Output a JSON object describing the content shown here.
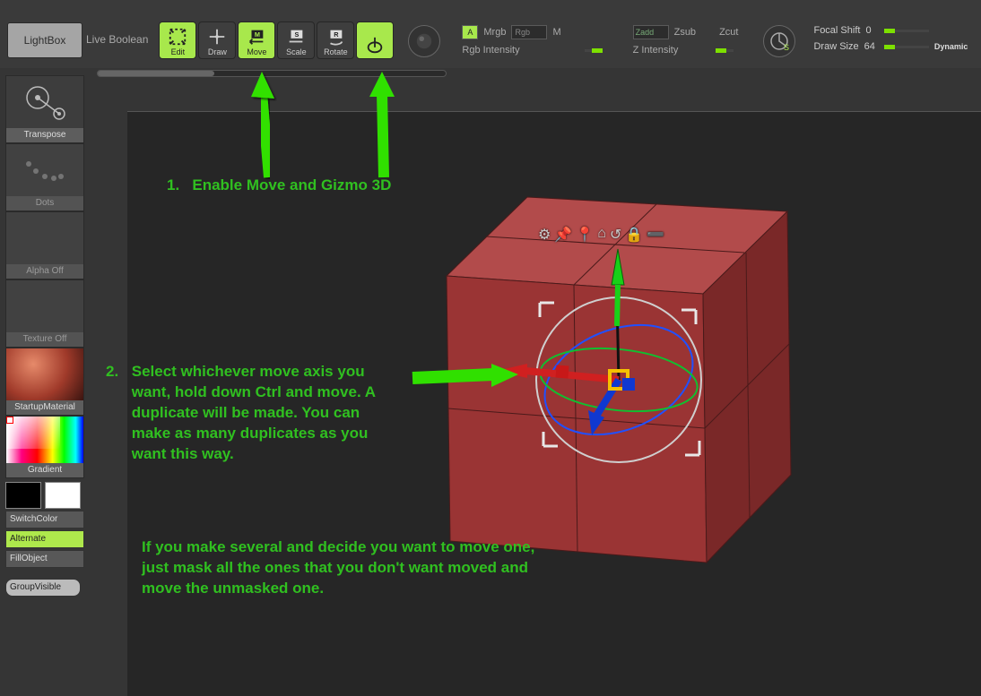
{
  "topbar": {
    "lightbox": "LightBox",
    "live_boolean": "Live Boolean",
    "tools": [
      {
        "id": "edit",
        "label": "Edit",
        "active": true
      },
      {
        "id": "draw",
        "label": "Draw",
        "active": false
      },
      {
        "id": "move",
        "label": "Move",
        "active": true
      },
      {
        "id": "scale",
        "label": "Scale",
        "active": false
      },
      {
        "id": "rotate",
        "label": "Rotate",
        "active": false
      },
      {
        "id": "gizmo",
        "label": "",
        "active": true
      }
    ],
    "color_mode": {
      "a_box": "A",
      "mrgb": "Mrgb",
      "rgb": "Rgb",
      "m": "M",
      "rgb_intensity_label": "Rgb Intensity"
    },
    "depth_mode": {
      "zadd": "Zadd",
      "zsub": "Zsub",
      "zcut": "Zcut",
      "z_intensity_label": "Z Intensity"
    },
    "right": {
      "focal_shift_label": "Focal Shift",
      "focal_shift_value": "0",
      "draw_size_label": "Draw Size",
      "draw_size_value": "64",
      "dynamic": "Dynamic"
    }
  },
  "sidebar": {
    "items": [
      {
        "label": "Transpose"
      },
      {
        "label": "Dots"
      },
      {
        "label": "Alpha Off"
      },
      {
        "label": "Texture Off"
      },
      {
        "label": "StartupMaterial"
      },
      {
        "label": "Gradient"
      }
    ],
    "switch_color": "SwitchColor",
    "alternate": "Alternate",
    "fill_object": "FillObject",
    "group_visible": "GroupVisible"
  },
  "annotations": {
    "step1_num": "1.",
    "step1_text": "Enable Move and Gizmo 3D",
    "step2_num": "2.",
    "step2_text": "Select whichever move axis you want, hold down Ctrl and move. A duplicate will be made. You can make as many duplicates as you want this way.",
    "tip_text": "If you make several and decide you want to move one, just mask all the ones that you don't want moved and move the unmasked one."
  },
  "gizmo_icons": [
    "gear-icon",
    "pin-icon",
    "location-icon",
    "home-icon",
    "undo-icon",
    "lock-icon",
    "minus-icon"
  ]
}
